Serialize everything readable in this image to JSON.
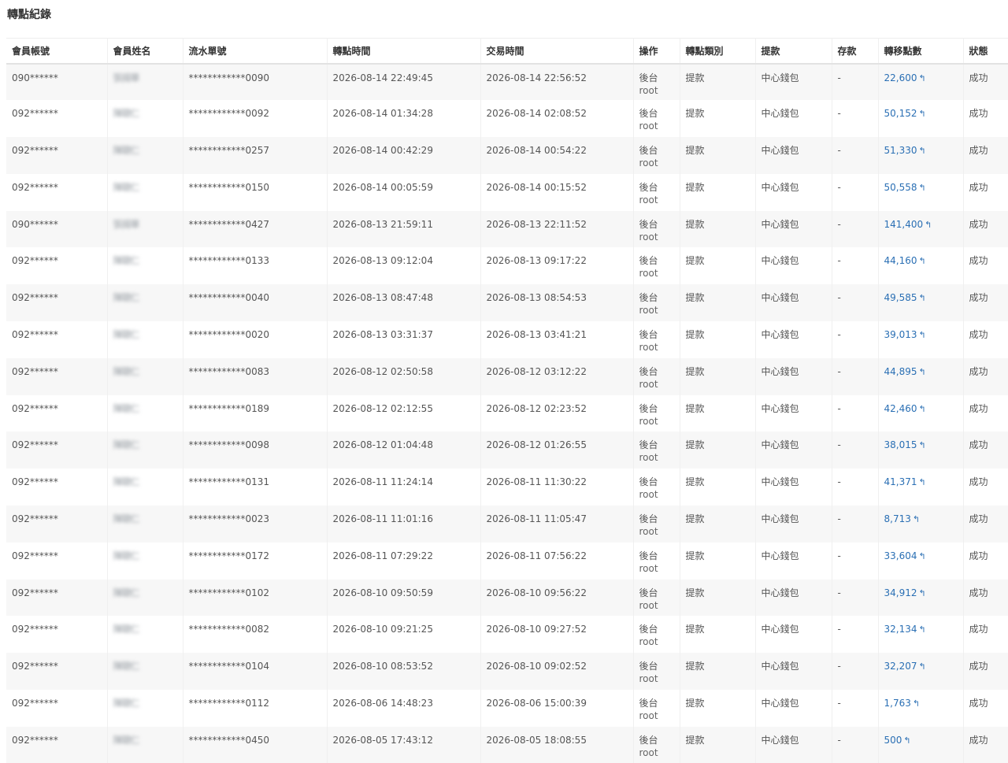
{
  "page": {
    "title": "轉點紀錄"
  },
  "table": {
    "headers": [
      "會員帳號",
      "會員姓名",
      "流水單號",
      "轉點時間",
      "交易時間",
      "操作",
      "轉點類別",
      "提款",
      "存款",
      "轉移點數",
      "狀態"
    ],
    "rows": [
      {
        "account": "090******",
        "name": "張揚華",
        "serial": "************0090",
        "transfer_time": "2026-08-14 22:49:45",
        "trade_time": "2026-08-14 22:56:52",
        "op": "後台",
        "op_user": "root",
        "category": "提款",
        "withdraw": "中心錢包",
        "deposit": "-",
        "points": "22,600",
        "status": "成功"
      },
      {
        "account": "092******",
        "name": "陳聰仁",
        "serial": "************0092",
        "transfer_time": "2026-08-14 01:34:28",
        "trade_time": "2026-08-14 02:08:52",
        "op": "後台",
        "op_user": "root",
        "category": "提款",
        "withdraw": "中心錢包",
        "deposit": "-",
        "points": "50,152",
        "status": "成功"
      },
      {
        "account": "092******",
        "name": "陳聰仁",
        "serial": "************0257",
        "transfer_time": "2026-08-14 00:42:29",
        "trade_time": "2026-08-14 00:54:22",
        "op": "後台",
        "op_user": "root",
        "category": "提款",
        "withdraw": "中心錢包",
        "deposit": "-",
        "points": "51,330",
        "status": "成功"
      },
      {
        "account": "092******",
        "name": "陳聰仁",
        "serial": "************0150",
        "transfer_time": "2026-08-14 00:05:59",
        "trade_time": "2026-08-14 00:15:52",
        "op": "後台",
        "op_user": "root",
        "category": "提款",
        "withdraw": "中心錢包",
        "deposit": "-",
        "points": "50,558",
        "status": "成功"
      },
      {
        "account": "090******",
        "name": "張揚華",
        "serial": "************0427",
        "transfer_time": "2026-08-13 21:59:11",
        "trade_time": "2026-08-13 22:11:52",
        "op": "後台",
        "op_user": "root",
        "category": "提款",
        "withdraw": "中心錢包",
        "deposit": "-",
        "points": "141,400",
        "status": "成功"
      },
      {
        "account": "092******",
        "name": "陳聰仁",
        "serial": "************0133",
        "transfer_time": "2026-08-13 09:12:04",
        "trade_time": "2026-08-13 09:17:22",
        "op": "後台",
        "op_user": "root",
        "category": "提款",
        "withdraw": "中心錢包",
        "deposit": "-",
        "points": "44,160",
        "status": "成功"
      },
      {
        "account": "092******",
        "name": "陳聰仁",
        "serial": "************0040",
        "transfer_time": "2026-08-13 08:47:48",
        "trade_time": "2026-08-13 08:54:53",
        "op": "後台",
        "op_user": "root",
        "category": "提款",
        "withdraw": "中心錢包",
        "deposit": "-",
        "points": "49,585",
        "status": "成功"
      },
      {
        "account": "092******",
        "name": "陳聰仁",
        "serial": "************0020",
        "transfer_time": "2026-08-13 03:31:37",
        "trade_time": "2026-08-13 03:41:21",
        "op": "後台",
        "op_user": "root",
        "category": "提款",
        "withdraw": "中心錢包",
        "deposit": "-",
        "points": "39,013",
        "status": "成功"
      },
      {
        "account": "092******",
        "name": "陳聰仁",
        "serial": "************0083",
        "transfer_time": "2026-08-12 02:50:58",
        "trade_time": "2026-08-12 03:12:22",
        "op": "後台",
        "op_user": "root",
        "category": "提款",
        "withdraw": "中心錢包",
        "deposit": "-",
        "points": "44,895",
        "status": "成功"
      },
      {
        "account": "092******",
        "name": "陳聰仁",
        "serial": "************0189",
        "transfer_time": "2026-08-12 02:12:55",
        "trade_time": "2026-08-12 02:23:52",
        "op": "後台",
        "op_user": "root",
        "category": "提款",
        "withdraw": "中心錢包",
        "deposit": "-",
        "points": "42,460",
        "status": "成功"
      },
      {
        "account": "092******",
        "name": "陳聰仁",
        "serial": "************0098",
        "transfer_time": "2026-08-12 01:04:48",
        "trade_time": "2026-08-12 01:26:55",
        "op": "後台",
        "op_user": "root",
        "category": "提款",
        "withdraw": "中心錢包",
        "deposit": "-",
        "points": "38,015",
        "status": "成功"
      },
      {
        "account": "092******",
        "name": "陳聰仁",
        "serial": "************0131",
        "transfer_time": "2026-08-11 11:24:14",
        "trade_time": "2026-08-11 11:30:22",
        "op": "後台",
        "op_user": "root",
        "category": "提款",
        "withdraw": "中心錢包",
        "deposit": "-",
        "points": "41,371",
        "status": "成功"
      },
      {
        "account": "092******",
        "name": "陳聰仁",
        "serial": "************0023",
        "transfer_time": "2026-08-11 11:01:16",
        "trade_time": "2026-08-11 11:05:47",
        "op": "後台",
        "op_user": "root",
        "category": "提款",
        "withdraw": "中心錢包",
        "deposit": "-",
        "points": "8,713",
        "status": "成功"
      },
      {
        "account": "092******",
        "name": "陳聰仁",
        "serial": "************0172",
        "transfer_time": "2026-08-11 07:29:22",
        "trade_time": "2026-08-11 07:56:22",
        "op": "後台",
        "op_user": "root",
        "category": "提款",
        "withdraw": "中心錢包",
        "deposit": "-",
        "points": "33,604",
        "status": "成功"
      },
      {
        "account": "092******",
        "name": "陳聰仁",
        "serial": "************0102",
        "transfer_time": "2026-08-10 09:50:59",
        "trade_time": "2026-08-10 09:56:22",
        "op": "後台",
        "op_user": "root",
        "category": "提款",
        "withdraw": "中心錢包",
        "deposit": "-",
        "points": "34,912",
        "status": "成功"
      },
      {
        "account": "092******",
        "name": "陳聰仁",
        "serial": "************0082",
        "transfer_time": "2026-08-10 09:21:25",
        "trade_time": "2026-08-10 09:27:52",
        "op": "後台",
        "op_user": "root",
        "category": "提款",
        "withdraw": "中心錢包",
        "deposit": "-",
        "points": "32,134",
        "status": "成功"
      },
      {
        "account": "092******",
        "name": "陳聰仁",
        "serial": "************0104",
        "transfer_time": "2026-08-10 08:53:52",
        "trade_time": "2026-08-10 09:02:52",
        "op": "後台",
        "op_user": "root",
        "category": "提款",
        "withdraw": "中心錢包",
        "deposit": "-",
        "points": "32,207",
        "status": "成功"
      },
      {
        "account": "092******",
        "name": "陳聰仁",
        "serial": "************0112",
        "transfer_time": "2026-08-06 14:48:23",
        "trade_time": "2026-08-06 15:00:39",
        "op": "後台",
        "op_user": "root",
        "category": "提款",
        "withdraw": "中心錢包",
        "deposit": "-",
        "points": "1,763",
        "status": "成功"
      },
      {
        "account": "092******",
        "name": "陳聰仁",
        "serial": "************0450",
        "transfer_time": "2026-08-05 17:43:12",
        "trade_time": "2026-08-05 18:08:55",
        "op": "後台",
        "op_user": "root",
        "category": "提款",
        "withdraw": "中心錢包",
        "deposit": "-",
        "points": "500",
        "status": "成功"
      }
    ]
  },
  "icons": {
    "points_action": "reply-arrow-icon",
    "points_action_glyph": "↰"
  },
  "colors": {
    "points_link": "#2a6fb4",
    "row_stripe": "#f7f7f7"
  }
}
